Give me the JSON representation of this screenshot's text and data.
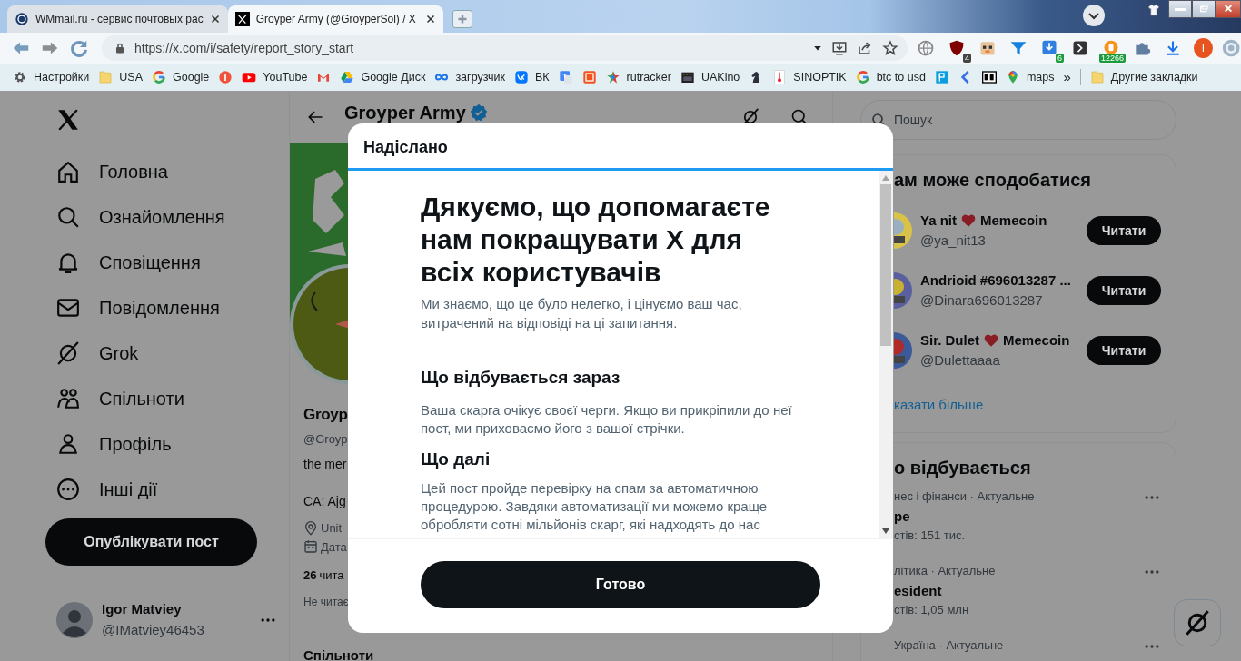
{
  "browser": {
    "tabs": [
      {
        "title": "WMmail.ru - сервис почтовых рас",
        "selected": false
      },
      {
        "title": "Groyper Army (@GroyperSol) / X",
        "selected": true
      }
    ],
    "url": "https://x.com/i/safety/report_story_start",
    "extensions": [
      {
        "kind": "globe"
      },
      {
        "kind": "shield",
        "badge": "4"
      },
      {
        "kind": "crate"
      },
      {
        "kind": "funnel"
      },
      {
        "kind": "download",
        "badge": "6"
      },
      {
        "kind": "terminal"
      },
      {
        "kind": "bitcoin",
        "badge": "12266"
      },
      {
        "kind": "puzzle"
      },
      {
        "kind": "arrow"
      }
    ],
    "profile_initial": "I",
    "bookmarks": [
      {
        "kind": "gear",
        "label": "Настройки"
      },
      {
        "kind": "folder",
        "label": "USA"
      },
      {
        "kind": "google",
        "label": "Google"
      },
      {
        "kind": "redcircle"
      },
      {
        "kind": "youtube",
        "label": "YouTube"
      },
      {
        "kind": "envelope"
      },
      {
        "kind": "drive",
        "label": "Google Диск"
      },
      {
        "kind": "infinity",
        "label": "загрузчик"
      },
      {
        "kind": "vk",
        "label": "ВК"
      },
      {
        "kind": "translate"
      },
      {
        "kind": "fsquare"
      },
      {
        "kind": "star",
        "label": "rutracker"
      },
      {
        "kind": "clapper",
        "label": "UAKino"
      },
      {
        "kind": "knight"
      },
      {
        "kind": "thermometer",
        "label": "SINOPTIK"
      },
      {
        "kind": "google",
        "label": "btc to usd"
      },
      {
        "kind": "psquare"
      },
      {
        "kind": "chevron"
      },
      {
        "kind": "bcbox"
      },
      {
        "kind": "pin",
        "label": "maps"
      }
    ],
    "bookmarks_overflow": "»",
    "other_bookmarks": "Другие закладки"
  },
  "sidebar": {
    "items": [
      {
        "kind": "home",
        "label": "Головна"
      },
      {
        "kind": "search",
        "label": "Ознайомлення"
      },
      {
        "kind": "bell",
        "label": "Сповіщення"
      },
      {
        "kind": "mail",
        "label": "Повідомлення"
      },
      {
        "kind": "grok",
        "label": "Grok"
      },
      {
        "kind": "communities",
        "label": "Спільноти"
      },
      {
        "kind": "person",
        "label": "Профіль"
      },
      {
        "kind": "more",
        "label": "Інші дії"
      }
    ],
    "post_button": "Опублікувати пост",
    "account": {
      "name": "Igor Matviey",
      "handle": "@IMatviey46453"
    }
  },
  "profile": {
    "title": "Groyper Army",
    "verified": true,
    "name": "Groyp",
    "handle": "@Groyp",
    "bio": "the mer",
    "ca": "CA: Ajg",
    "location": "Unit",
    "joined": "Дата",
    "following_count": "26",
    "following_label": "чита",
    "followers_note": "Не читає",
    "communities_heading": "Спільноти"
  },
  "right": {
    "search_placeholder": "Пошук",
    "suggestions": {
      "title": "ам може сподобатися",
      "users": [
        {
          "name": "Ya nit",
          "heart": true,
          "name_suffix": "Memecoin",
          "handle": "@ya_nit13",
          "button": "Читати"
        },
        {
          "name": "Andrioid #696013287 ...",
          "heart": false,
          "handle": "@Dinara696013287",
          "button": "Читати"
        },
        {
          "name": "Sir. Dulet",
          "heart": true,
          "name_suffix": "Memecoin",
          "handle": "@Dulettaaaa",
          "button": "Читати"
        }
      ],
      "show_more": "казати більше"
    },
    "trends": {
      "title": "о відбувається",
      "items": [
        {
          "category": "нес і фінанси · Актуальне",
          "name": "pe",
          "count": "стів: 151 тис."
        },
        {
          "category": "літика · Актуальне",
          "name": "esident",
          "count": "стів: 1,05 млн"
        },
        {
          "category": "Україна · Актуальне"
        }
      ]
    }
  },
  "modal": {
    "header": "Надіслано",
    "heading": "Дякуємо, що допомагаєте нам покращувати X для всіх користувачів",
    "intro": "Ми знаємо, що це було нелегко, і цінуємо ваш час, витрачений на відповіді на ці запитання.",
    "sections": [
      {
        "title": "Що відбувається зараз",
        "text": "Ваша скарга очікує своєї черги. Якщо ви прикріпили до неї пост, ми приховаємо його з вашої стрічки."
      },
      {
        "title": "Що далі",
        "text": "Цей пост пройде перевірку на спам за автоматичною процедурою. Завдяки автоматизації ми можемо краще обробляти сотні мільйонів скарг, які надходять до нас"
      }
    ],
    "button": "Готово"
  }
}
